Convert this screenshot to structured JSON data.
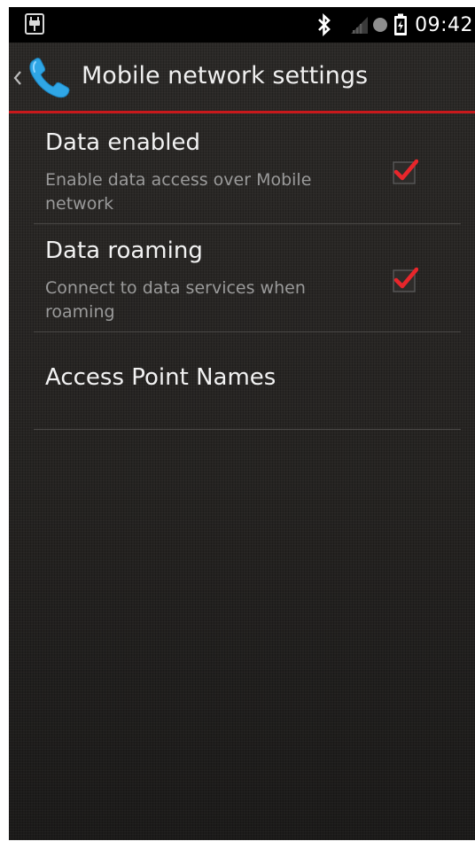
{
  "statusbar": {
    "time": "09:42",
    "icons": [
      "usb-debug-icon",
      "bluetooth-icon",
      "signal-icon",
      "sync-dot-icon",
      "battery-charging-icon"
    ]
  },
  "actionbar": {
    "title": "Mobile network settings",
    "app_icon": "phone-icon",
    "up_icon": "chevron-left-icon"
  },
  "preferences": [
    {
      "title": "Data enabled",
      "summary": "Enable data access over Mobile network",
      "checked": true
    },
    {
      "title": "Data roaming",
      "summary": "Connect to data services when roaming",
      "checked": true
    },
    {
      "title": "Access Point Names"
    }
  ],
  "colors": {
    "accent": "#c8191c",
    "check": "#e8262b",
    "background": "#262422",
    "app_icon": "#2fa6e6"
  }
}
